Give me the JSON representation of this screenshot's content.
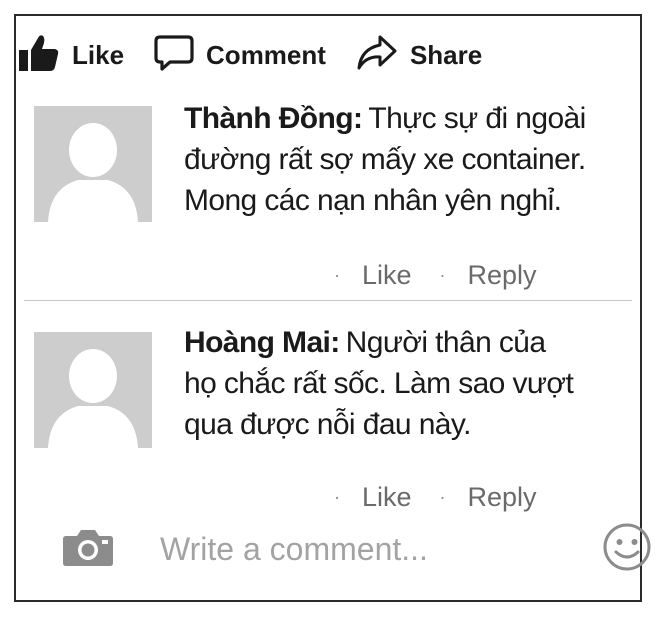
{
  "actions": {
    "like": "Like",
    "comment": "Comment",
    "share": "Share"
  },
  "comments": [
    {
      "author": "Thành Đồng:",
      "lines": [
        "Thực sự đi ngoài",
        "đường rất sợ mấy xe container.",
        "Mong các nạn nhân yên nghỉ."
      ],
      "like": "Like",
      "reply": "Reply"
    },
    {
      "author": "Hoàng Mai:",
      "lines": [
        "Người thân của",
        "họ chắc rất sốc. Làm sao vượt",
        "qua được nỗi đau này."
      ],
      "like": "Like",
      "reply": "Reply"
    }
  ],
  "composer": {
    "placeholder": "Write a comment..."
  },
  "icons": {
    "like": "thumbs-up-icon",
    "comment": "speech-bubble-icon",
    "share": "share-arrow-icon",
    "camera": "camera-icon",
    "emoji": "smiley-icon"
  }
}
